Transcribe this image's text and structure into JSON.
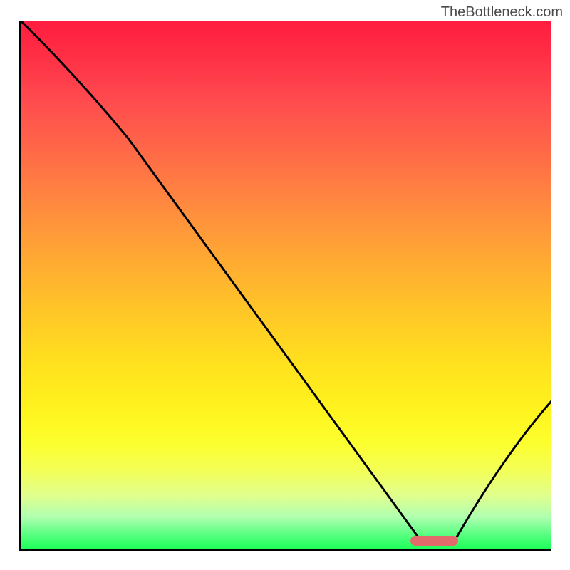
{
  "watermark": "TheBottleneck.com",
  "chart_data": {
    "type": "line",
    "title": "",
    "xlabel": "",
    "ylabel": "",
    "xlim": [
      0,
      100
    ],
    "ylim": [
      0,
      100
    ],
    "series": [
      {
        "name": "curve",
        "x": [
          0,
          20,
          75,
          82,
          100
        ],
        "y": [
          100,
          78,
          2,
          2,
          28
        ]
      }
    ],
    "marker": {
      "x_start": 73,
      "x_end": 82,
      "y": 2
    },
    "gradient_stops": [
      {
        "pct": 0,
        "color": "#ff1d3f"
      },
      {
        "pct": 50,
        "color": "#ffc627"
      },
      {
        "pct": 80,
        "color": "#fcff2e"
      },
      {
        "pct": 100,
        "color": "#1eff5a"
      }
    ]
  }
}
